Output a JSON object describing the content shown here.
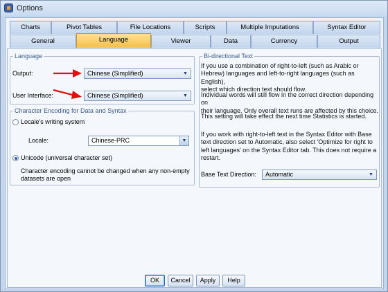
{
  "window": {
    "title": "Options"
  },
  "tabs_row1": [
    "Charts",
    "Pivot Tables",
    "File Locations",
    "Scripts",
    "Multiple Imputations",
    "Syntax Editor"
  ],
  "tabs_row2": [
    "General",
    "Language",
    "Viewer",
    "Data",
    "Currency",
    "Output"
  ],
  "active_tab": "Language",
  "language_group": {
    "legend": "Language",
    "output_label": "Output:",
    "output_value": "Chinese (Simplified)",
    "ui_label": "User Interface:",
    "ui_value": "Chinese (Simplified)"
  },
  "encoding_group": {
    "legend": "Character Encoding for Data and Syntax",
    "locale_option": "Locale's writing system",
    "locale_label": "Locale:",
    "locale_value": "Chinese-PRC",
    "unicode_option": "Unicode (universal character set)",
    "selected": "unicode",
    "note_line1": "Character encoding cannot be changed when any non-empty",
    "note_line2": "datasets are open"
  },
  "bidi_group": {
    "legend": "Bi-directional Text",
    "p1_lines": [
      "If you use a combination of right-to-left (such as Arabic or",
      "Hebrew) languages and left-to-right languages (such as English),",
      "select which direction text should flow."
    ],
    "p2_lines": [
      "Individual words will still flow in the correct direction depending on",
      "their language. Only overall text runs are affected by this choice."
    ],
    "p3_lines": [
      "This setting will take effect the next time Statistics is started."
    ],
    "p4_lines": [
      "If you work with right-to-left text in the Syntax Editor with Base",
      "text direction set to Automatic, also select 'Optimize for right to",
      "left languages' on the Syntax Editor tab. This does not require a",
      "restart."
    ],
    "base_label": "Base Text Direction:",
    "base_value": "Automatic"
  },
  "buttons": {
    "ok": "OK",
    "cancel": "Cancel",
    "apply": "Apply",
    "help": "Help"
  },
  "colors": {
    "active_tab": "#f5c048",
    "annotation_arrow": "#e01010",
    "accent": "#2a58b0"
  },
  "icons": {
    "combo_arrow": "chevron-down-icon",
    "annotation": "red-arrow-icon"
  }
}
